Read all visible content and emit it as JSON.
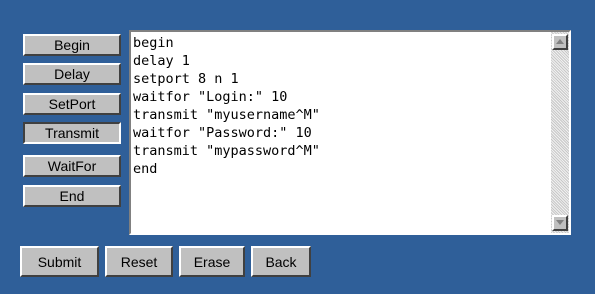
{
  "side_buttons": {
    "begin": "Begin",
    "delay": "Delay",
    "setport": "SetPort",
    "transmit": "Transmit",
    "waitfor": "WaitFor",
    "end": "End"
  },
  "script_lines": [
    "begin",
    "delay 1",
    "setport 8 n 1",
    "waitfor \"Login:\" 10",
    "transmit \"myusername^M\"",
    "waitfor \"Password:\" 10",
    "transmit \"mypassword^M\"",
    "end"
  ],
  "bottom_buttons": {
    "submit": "Submit",
    "reset": "Reset",
    "erase": "Erase",
    "back": "Back"
  },
  "icons": {
    "scroll_up": "up-arrow-icon",
    "scroll_down": "down-arrow-icon"
  },
  "colors": {
    "background": "#2f5f99",
    "button_face": "#c0c0c0"
  }
}
